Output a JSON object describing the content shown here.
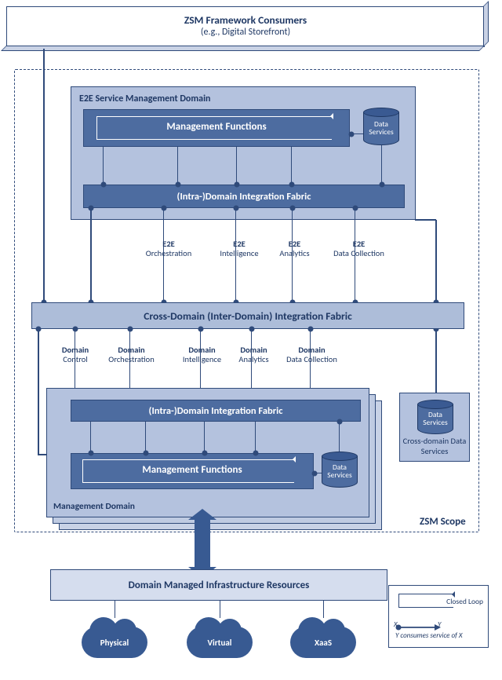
{
  "top": {
    "title": "ZSM Framework Consumers",
    "subtitle": "(e.g., Digital Storefront)"
  },
  "labels": {
    "zsm_scope": "ZSM Scope"
  },
  "e2e": {
    "title": "E2E Service Management Domain",
    "mgmt_functions": "Management Functions",
    "fabric": "(Intra-)Domain Integration Fabric",
    "data_services": "Data Services"
  },
  "e2e_services": [
    {
      "l1": "E2E",
      "l2": "Orchestration"
    },
    {
      "l1": "E2E",
      "l2": "Intelligence"
    },
    {
      "l1": "E2E",
      "l2": "Analytics"
    },
    {
      "l1": "E2E",
      "l2": "Data Collection"
    }
  ],
  "cross_fabric": "Cross-Domain (Inter-Domain) Integration Fabric",
  "domain_services": [
    {
      "l1": "Domain",
      "l2": "Control"
    },
    {
      "l1": "Domain",
      "l2": "Orchestration"
    },
    {
      "l1": "Domain",
      "l2": "Intelligence"
    },
    {
      "l1": "Domain",
      "l2": "Analytics"
    },
    {
      "l1": "Domain",
      "l2": "Data Collection"
    }
  ],
  "mgmt": {
    "title": "Management Domain",
    "fabric": "(Intra-)Domain Integration Fabric",
    "mgmt_functions": "Management Functions",
    "data_services": "Data Services"
  },
  "cross_ds": {
    "db": "Data Services",
    "title": "Cross-domain Data Services"
  },
  "infra": {
    "title": "Domain Managed Infrastructure Resources",
    "clouds": [
      "Physical",
      "Virtual",
      "XaaS"
    ]
  },
  "legend": {
    "closed_loop": "Closed Loop",
    "consume": "Y consumes service of X",
    "x": "X",
    "y": "Y"
  }
}
